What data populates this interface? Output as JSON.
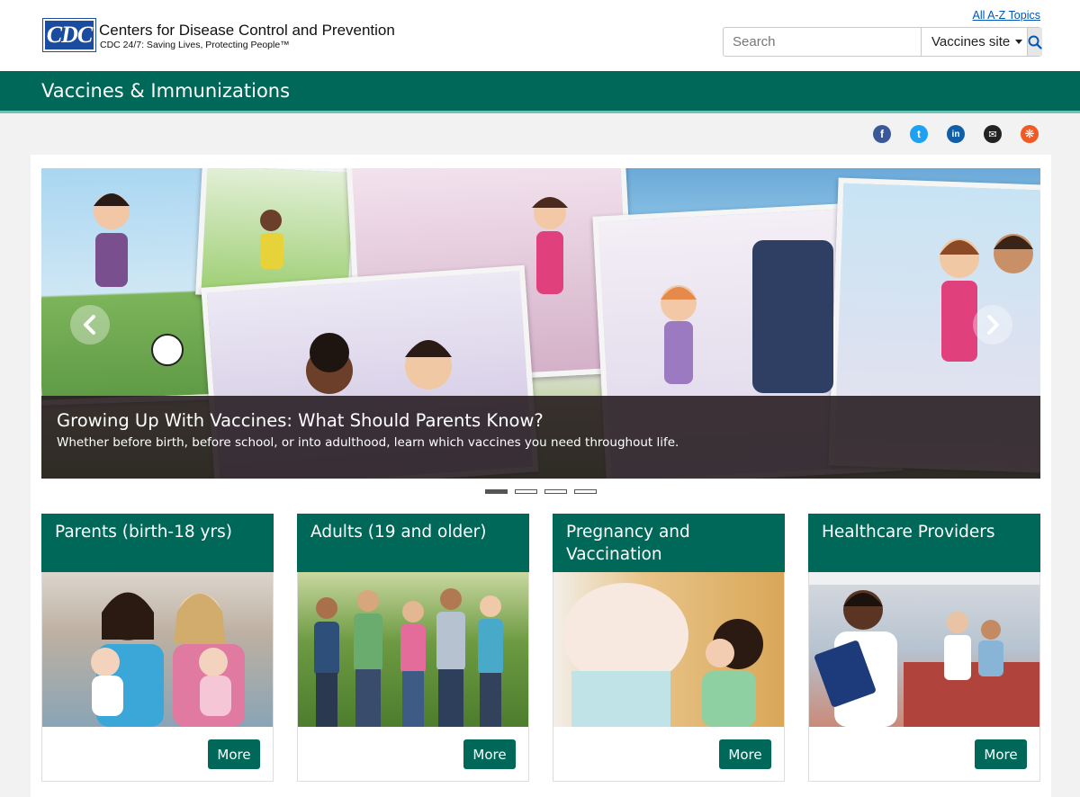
{
  "header": {
    "logo_text": "CDC",
    "brand_name": "Centers for Disease Control and Prevention",
    "brand_tagline": "CDC 24/7: Saving Lives, Protecting People™",
    "az_link": "All A-Z Topics",
    "search_placeholder": "Search",
    "site_select": "Vaccines site"
  },
  "titlebar": {
    "title": "Vaccines & Immunizations"
  },
  "social": [
    {
      "name": "facebook-icon",
      "glyph": "f",
      "color": "#3b5998"
    },
    {
      "name": "twitter-icon",
      "glyph": "t",
      "color": "#1da1f2"
    },
    {
      "name": "linkedin-icon",
      "glyph": "in",
      "color": "#0e5fa8"
    },
    {
      "name": "email-icon",
      "glyph": "✉",
      "color": "#222222"
    },
    {
      "name": "syndicate-icon",
      "glyph": "❋",
      "color": "#f05a24"
    }
  ],
  "carousel": {
    "title": "Growing Up With Vaccines: What Should Parents Know?",
    "text": "Whether before birth, before school, or into adulthood, learn which vaccines you need throughout life.",
    "slide_count": 4,
    "active_slide": 1
  },
  "cards": [
    {
      "title": "Parents (birth-18 yrs)",
      "button": "More"
    },
    {
      "title": "Adults (19 and older)",
      "button": "More"
    },
    {
      "title": "Pregnancy and Vaccination",
      "button": "More"
    },
    {
      "title": "Healthcare Providers",
      "button": "More"
    }
  ],
  "colors": {
    "brand_green": "#006858",
    "accent_teal": "#6cc4b5",
    "cdc_blue": "#1a4da0"
  }
}
